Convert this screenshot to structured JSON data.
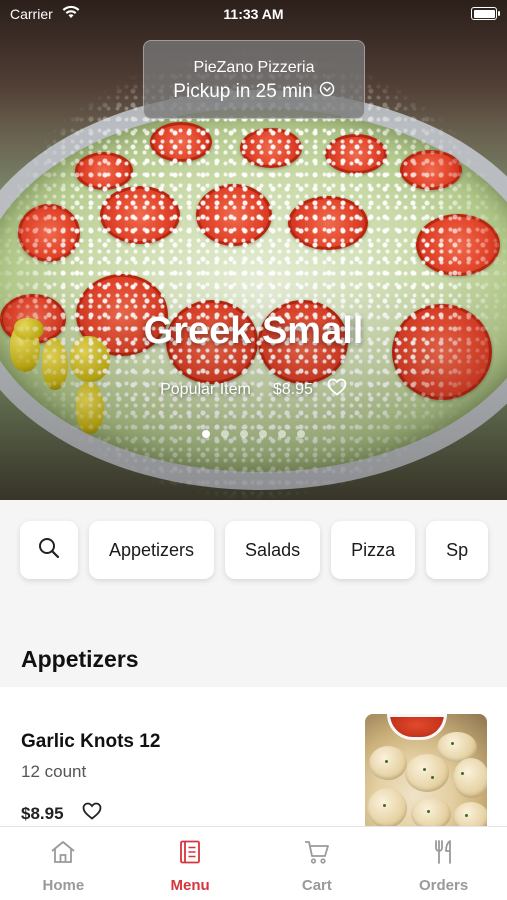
{
  "status_bar": {
    "carrier": "Carrier",
    "time": "11:33 AM"
  },
  "restaurant": {
    "name": "PieZano Pizzeria",
    "pickup": "Pickup in 25 min",
    "pickup_icon": "chevron-down-circle-icon"
  },
  "hero": {
    "title": "Greek Small",
    "tag": "Popular Item",
    "price": "$8.95",
    "favorite_icon": "heart-outline-icon",
    "page_count": 6,
    "active_page": 1
  },
  "categories": {
    "search_icon": "search-icon",
    "items": [
      "Appetizers",
      "Salads",
      "Pizza",
      "Sp"
    ]
  },
  "section": {
    "title": "Appetizers"
  },
  "menu_item": {
    "name": "Garlic Knots 12",
    "description": "12 count",
    "price": "$8.95",
    "favorite_icon": "heart-outline-icon"
  },
  "tabs": [
    {
      "label": "Home",
      "icon": "home-icon",
      "active": false
    },
    {
      "label": "Menu",
      "icon": "menu-book-icon",
      "active": true
    },
    {
      "label": "Cart",
      "icon": "cart-icon",
      "active": false
    },
    {
      "label": "Orders",
      "icon": "utensils-icon",
      "active": false
    }
  ],
  "colors": {
    "accent": "#d8343b",
    "inactive": "#9a9a9a"
  }
}
